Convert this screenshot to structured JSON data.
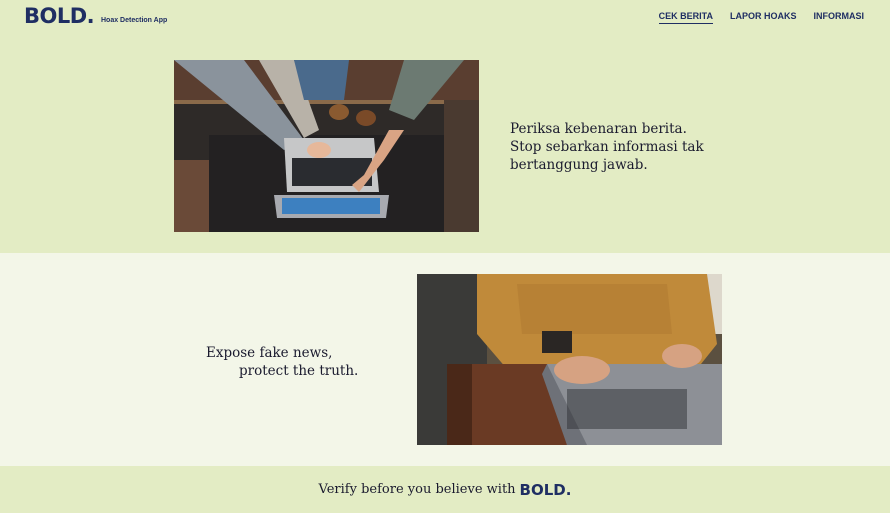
{
  "brand": {
    "logo": "BOLD.",
    "tagline": "Hoax Detection App"
  },
  "nav": {
    "items": [
      "CEK BERITA",
      "LAPOR HOAKS",
      "INFORMASI"
    ],
    "active": "CEK BERITA"
  },
  "hero": {
    "lines": [
      "Periksa kebenaran berita.",
      "Stop sebarkan informasi tak",
      "bertanggung jawab."
    ]
  },
  "second": {
    "lines": [
      "Expose fake news,",
      "protect the truth."
    ]
  },
  "footer": {
    "text": "Verify before you believe with",
    "brand": "BOLD."
  },
  "colors": {
    "brand": "#1f2e63",
    "bg_green": "#e3ecc4",
    "bg_light": "#f3f6e8"
  }
}
